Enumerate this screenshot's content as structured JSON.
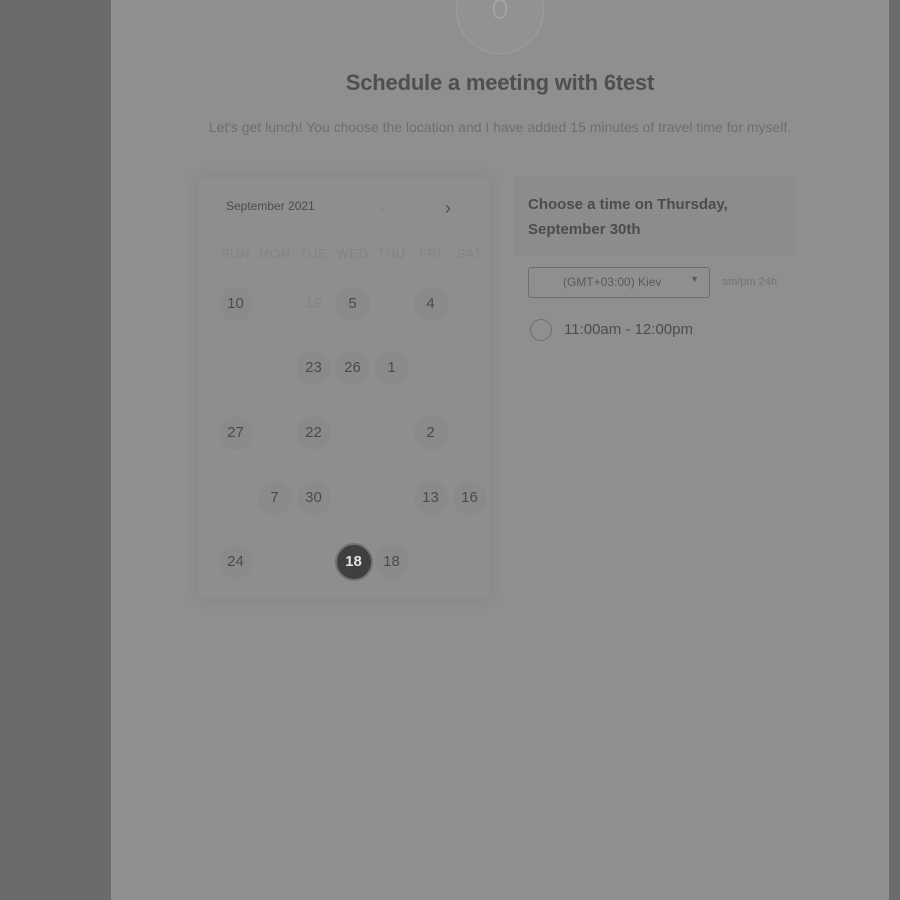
{
  "header": {
    "title": "Schedule a meeting with 6test",
    "subtitle": "Let's get lunch! You choose the location and I have added 15 minutes of travel time for myself."
  },
  "calendar": {
    "month_label": "September 2021",
    "prev_icon": "‹",
    "next_icon": "›",
    "weekdays": [
      "SUN",
      "MON",
      "TUE",
      "WED",
      "THU",
      "FRI",
      "SAT"
    ],
    "days": [
      {
        "label": "10",
        "state": "available",
        "row": 0,
        "col": 0
      },
      {
        "label": "19",
        "state": "muted",
        "row": 0,
        "col": 2
      },
      {
        "label": "5",
        "state": "available",
        "row": 0,
        "col": 3
      },
      {
        "label": "4",
        "state": "available",
        "row": 0,
        "col": 5
      },
      {
        "label": "23",
        "state": "available",
        "row": 1,
        "col": 2
      },
      {
        "label": "26",
        "state": "available",
        "row": 1,
        "col": 3
      },
      {
        "label": "1",
        "state": "available",
        "row": 1,
        "col": 4
      },
      {
        "label": "27",
        "state": "available",
        "row": 2,
        "col": 0
      },
      {
        "label": "22",
        "state": "available",
        "row": 2,
        "col": 2
      },
      {
        "label": "2",
        "state": "available",
        "row": 2,
        "col": 5
      },
      {
        "label": "7",
        "state": "available",
        "row": 3,
        "col": 1
      },
      {
        "label": "30",
        "state": "available",
        "row": 3,
        "col": 2
      },
      {
        "label": "13",
        "state": "available",
        "row": 3,
        "col": 5
      },
      {
        "label": "16",
        "state": "available",
        "row": 3,
        "col": 6
      },
      {
        "label": "24",
        "state": "available",
        "row": 4,
        "col": 0
      },
      {
        "label": "18",
        "state": "selected",
        "row": 4,
        "col": 3
      },
      {
        "label": "18",
        "state": "available",
        "row": 4,
        "col": 4
      }
    ]
  },
  "time_panel": {
    "title": "Choose a time on Thursday, September 30th",
    "timezone": "(GMT+03:00) Kiev",
    "format_toggle": "am/pm  24h",
    "slots": [
      {
        "label": "11:00am - 12:00pm"
      }
    ]
  }
}
